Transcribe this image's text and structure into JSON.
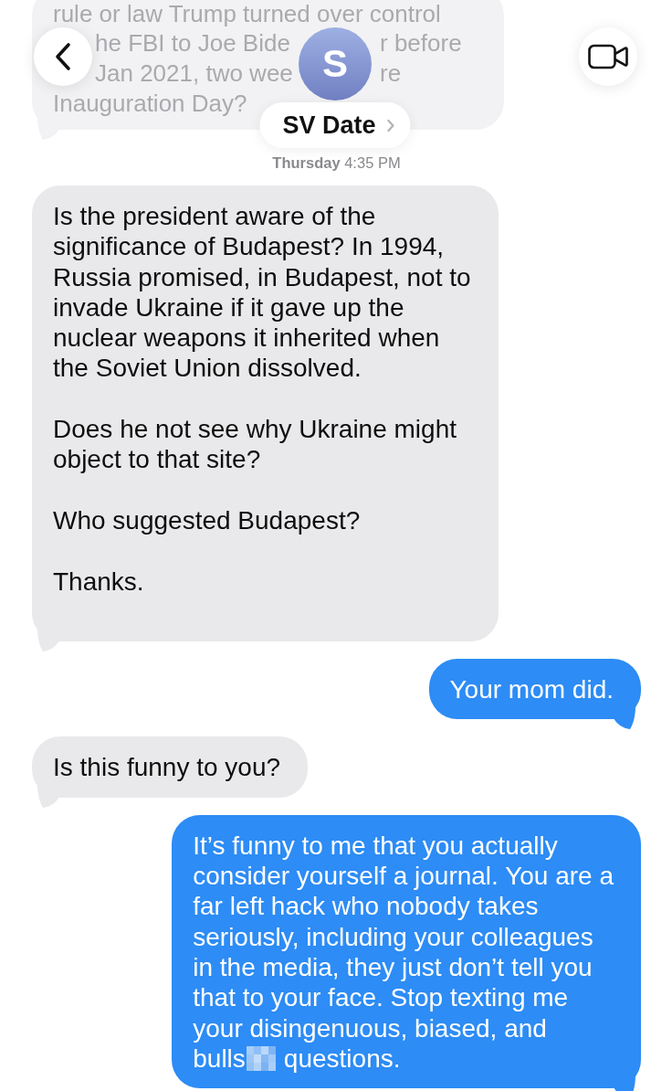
{
  "header": {
    "contact": {
      "initial": "S",
      "name": "SV Date"
    }
  },
  "thread": [
    {
      "kind": "obscured-incoming-message",
      "lines": [
        [
          "rule or law Trump turned over control"
        ],
        [
          "he FBI to Joe Bide",
          "r before"
        ],
        [
          "Jan 2021, two wee",
          "re"
        ],
        [
          "Inauguration Day?"
        ]
      ]
    },
    {
      "kind": "timestamp",
      "text": "**Thursday** 4:35 PM"
    },
    {
      "kind": "incoming-message",
      "trailing_blank_line": true,
      "paragraphs": [
        [
          {
            "kind": "text",
            "text": "Is the president aware of the\nsignificance of Budapest? In 1994,\nRussia promised, in Budapest, not to\ninvade Ukraine if it gave up the\nnuclear weapons it inherited when\nthe Soviet Union dissolved."
          }
        ],
        [
          {
            "kind": "text",
            "text": "Does he not see why Ukraine might\nobject to that site?"
          }
        ],
        [
          {
            "kind": "text",
            "text": "Who suggested Budapest?"
          }
        ],
        [
          {
            "kind": "text",
            "text": "Thanks."
          }
        ]
      ]
    },
    {
      "kind": "outgoing-message",
      "paragraphs": [
        [
          {
            "kind": "text",
            "text": "Your mom did."
          }
        ]
      ]
    },
    {
      "kind": "incoming-message",
      "paragraphs": [
        [
          {
            "kind": "text",
            "text": "Is this funny to you?"
          }
        ]
      ]
    },
    {
      "kind": "outgoing-message",
      "paragraphs": [
        [
          {
            "kind": "text",
            "text": "It’s funny to me that you actually\nconsider yourself a journal. You are a\nfar left hack who nobody takes\nseriously, including your colleagues\nin the media, they just don’t tell you\nthat to your face. Stop texting me\nyour disingenuous, biased, and"
          },
          {
            "kind": "redacted-line",
            "before": "bulls",
            "after": "questions."
          }
        ]
      ]
    }
  ]
}
